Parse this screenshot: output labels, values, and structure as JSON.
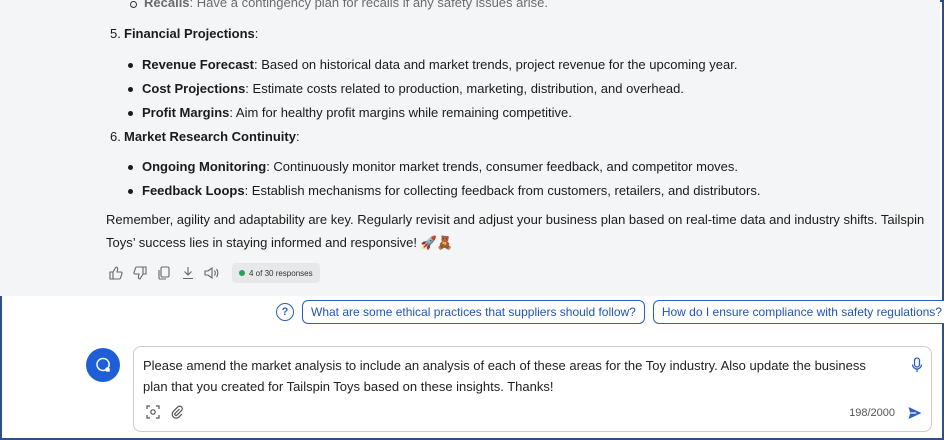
{
  "response": {
    "cut_item": {
      "title": "Recalls",
      "text": ": Have a contingency plan for recalls if any safety issues arise."
    },
    "sections": [
      {
        "number": "5.",
        "title": "Financial Projections",
        "suffix": ":",
        "bullets": [
          {
            "title": "Revenue Forecast",
            "text": ": Based on historical data and market trends, project revenue for the upcoming year."
          },
          {
            "title": "Cost Projections",
            "text": ": Estimate costs related to production, marketing, distribution, and overhead."
          },
          {
            "title": "Profit Margins",
            "text": ": Aim for healthy profit margins while remaining competitive."
          }
        ]
      },
      {
        "number": "6.",
        "title": "Market Research Continuity",
        "suffix": ":",
        "bullets": [
          {
            "title": "Ongoing Monitoring",
            "text": ": Continuously monitor market trends, consumer feedback, and competitor moves."
          },
          {
            "title": "Feedback Loops",
            "text": ": Establish mechanisms for collecting feedback from customers, retailers, and distributors."
          }
        ]
      }
    ],
    "closing": "Remember, agility and adaptability are key. Regularly revisit and adjust your business plan based on real-time data and industry shifts. Tailspin Toys’ success lies in staying informed and responsive! 🚀🧸",
    "response_counter": "4 of 30 responses"
  },
  "actions": {
    "icons": [
      "thumbs-up-icon",
      "thumbs-down-icon",
      "copy-icon",
      "download-icon",
      "speaker-icon"
    ]
  },
  "suggestions": [
    "What are some ethical practices that suppliers should follow?",
    "How do I ensure compliance with safety regulations?"
  ],
  "composer": {
    "text": "Please amend the market analysis to include an analysis of each of these areas for the Toy industry. Also update the business plan that you created for Tailspin Toys based on these insights. Thanks!",
    "char_count": "198/2000"
  },
  "colors": {
    "accent": "#1f5fd6",
    "frame": "#2e4f8a",
    "chat_bg": "#f4f5f6",
    "status_green": "#23a559"
  }
}
